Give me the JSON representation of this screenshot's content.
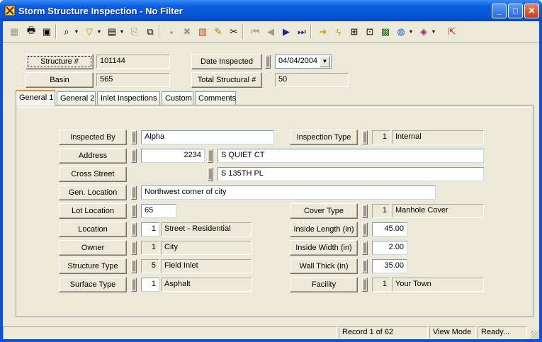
{
  "window": {
    "title": "Storm Structure Inspection - No Filter"
  },
  "header": {
    "structure_label": "Structure #",
    "structure_value": "101144",
    "basin_label": "Basin",
    "basin_value": "565",
    "date_label": "Date Inspected",
    "date_value": "04/04/2004",
    "total_label": "Total Structural #",
    "total_value": "50"
  },
  "tabs": [
    {
      "label": "General 1",
      "active": true
    },
    {
      "label": "General 2",
      "active": false
    },
    {
      "label": "Inlet Inspections",
      "active": false
    },
    {
      "label": "Custom",
      "active": false
    },
    {
      "label": "Comments",
      "active": false
    }
  ],
  "form": {
    "inspected_by": {
      "label": "Inspected By",
      "value": "Alpha"
    },
    "address": {
      "label": "Address",
      "number": "2234",
      "street": "S QUIET CT"
    },
    "cross_street": {
      "label": "Cross Street",
      "value": "S 135TH PL"
    },
    "gen_location": {
      "label": "Gen. Location",
      "value": "Northwest corner of city"
    },
    "lot_location": {
      "label": "Lot Location",
      "value": "65"
    },
    "location": {
      "label": "Location",
      "code": "1",
      "value": "Street - Residential"
    },
    "owner": {
      "label": "Owner",
      "code": "1",
      "value": "City"
    },
    "structure_type": {
      "label": "Structure Type",
      "code": "5",
      "value": "Field Inlet"
    },
    "surface_type": {
      "label": "Surface Type",
      "code": "1",
      "value": "Asphalt"
    },
    "inspection_type": {
      "label": "Inspection Type",
      "code": "1",
      "value": "Internal"
    },
    "cover_type": {
      "label": "Cover Type",
      "code": "1",
      "value": "Manhole Cover"
    },
    "inside_length": {
      "label": "Inside Length (in)",
      "value": "45.00"
    },
    "inside_width": {
      "label": "Inside Width (in)",
      "value": "2.00"
    },
    "wall_thick": {
      "label": "Wall Thick (in)",
      "value": "35.00"
    },
    "facility": {
      "label": "Facility",
      "code": "1",
      "value": "Your Town"
    }
  },
  "status": {
    "record": "Record 1 of 62",
    "mode": "View Mode",
    "state": "Ready..."
  },
  "colors": {
    "titlebar": "#0a55d8",
    "window_bg": "#ece9d8",
    "tab_accent": "#e68b2c"
  }
}
